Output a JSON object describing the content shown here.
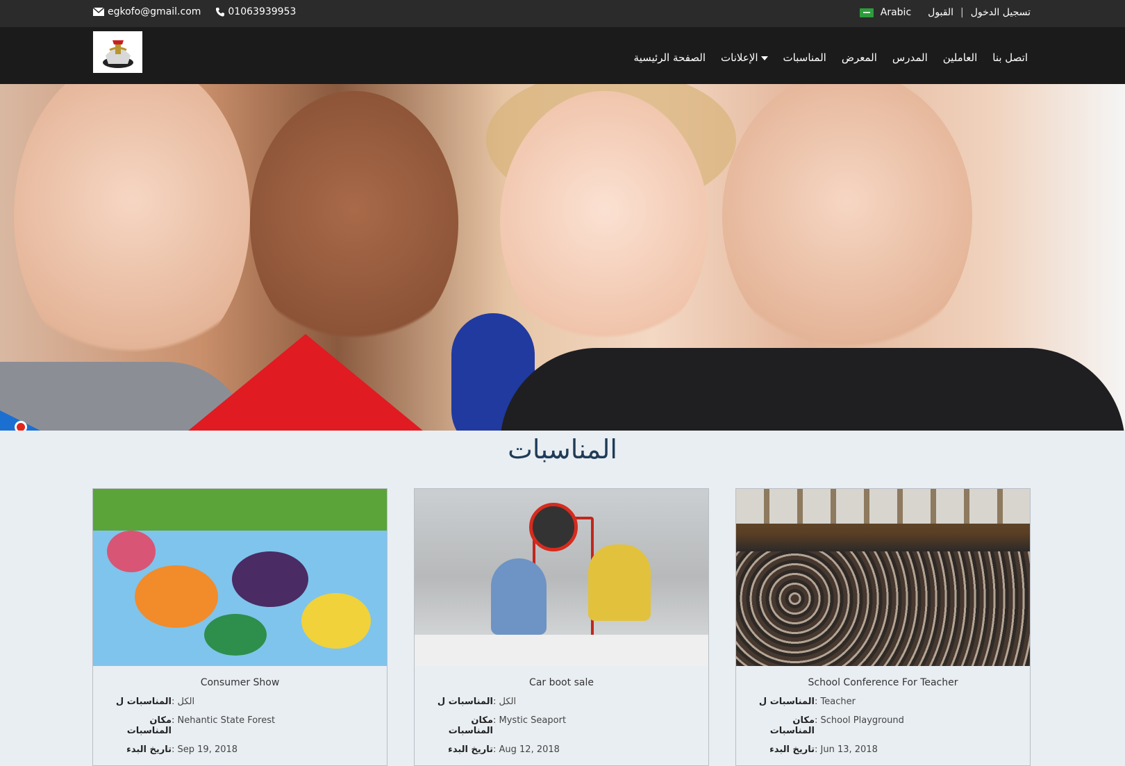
{
  "topbar": {
    "email": "egkofo@gmail.com",
    "phone": "01063939953",
    "language": "Arabic",
    "acceptance": "القبول",
    "separator": "|",
    "login": "تسجيل الدخول"
  },
  "nav": {
    "items": [
      {
        "label": "اتصل بنا"
      },
      {
        "label": "العاملين"
      },
      {
        "label": "المدرس"
      },
      {
        "label": "المعرض"
      },
      {
        "label": "المناسبات"
      },
      {
        "label": "الإعلانات"
      },
      {
        "label": "الصفحة الرئيسية"
      }
    ]
  },
  "slider": {
    "dot_count": 5,
    "active_index": 2
  },
  "events": {
    "title": "المناسبات",
    "cards": [
      {
        "title": "Consumer Show",
        "rows": [
          {
            "label": "المناسبات ل",
            "value": ": الكل"
          },
          {
            "label": "مكان المناسبات",
            "value": ": Nehantic State Forest"
          },
          {
            "label": "تاريخ البدء",
            "value": ": Sep 19, 2018"
          }
        ]
      },
      {
        "title": "Car boot sale",
        "rows": [
          {
            "label": "المناسبات ل",
            "value": ": الكل"
          },
          {
            "label": "مكان المناسبات",
            "value": ": Mystic Seaport"
          },
          {
            "label": "تاريخ البدء",
            "value": ": Aug 12, 2018"
          }
        ]
      },
      {
        "title": "School Conference For Teacher",
        "rows": [
          {
            "label": "المناسبات ل",
            "value": ": Teacher"
          },
          {
            "label": "مكان المناسبات",
            "value": ": School Playground"
          },
          {
            "label": "تاريخ البدء",
            "value": ": Jun 13, 2018"
          }
        ]
      }
    ]
  },
  "colors": {
    "topbar_bg": "#2b2b2b",
    "navbar_bg": "#1b1b1b",
    "page_bg": "#e9eef3",
    "title_color": "#1f3b56",
    "dot_active": "#1e8fe0",
    "dot_inactive": "#e2261b"
  }
}
